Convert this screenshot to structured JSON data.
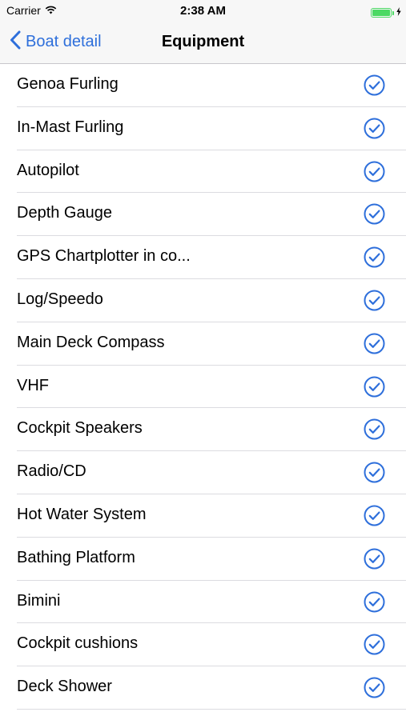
{
  "status_bar": {
    "carrier": "Carrier",
    "time": "2:38 AM",
    "battery_level": 1.0,
    "wifi_icon": "wifi-icon",
    "battery_icon": "battery-icon"
  },
  "nav": {
    "back_label": "Boat detail",
    "back_icon": "chevron-left-icon",
    "title": "Equipment"
  },
  "colors": {
    "accent": "#2e6fdb",
    "battery": "#4cd964",
    "separator": "#dcdce0"
  },
  "equipment": [
    {
      "label": "Genoa Furling",
      "checked": true
    },
    {
      "label": "In-Mast Furling",
      "checked": true
    },
    {
      "label": "Autopilot",
      "checked": true
    },
    {
      "label": "Depth Gauge",
      "checked": true
    },
    {
      "label": "GPS Chartplotter in co...",
      "checked": true
    },
    {
      "label": "Log/Speedo",
      "checked": true
    },
    {
      "label": "Main Deck Compass",
      "checked": true
    },
    {
      "label": "VHF",
      "checked": true
    },
    {
      "label": "Cockpit Speakers",
      "checked": true
    },
    {
      "label": "Radio/CD",
      "checked": true
    },
    {
      "label": "Hot Water System",
      "checked": true
    },
    {
      "label": "Bathing Platform",
      "checked": true
    },
    {
      "label": "Bimini",
      "checked": true
    },
    {
      "label": "Cockpit cushions",
      "checked": true
    },
    {
      "label": "Deck Shower",
      "checked": true
    }
  ]
}
